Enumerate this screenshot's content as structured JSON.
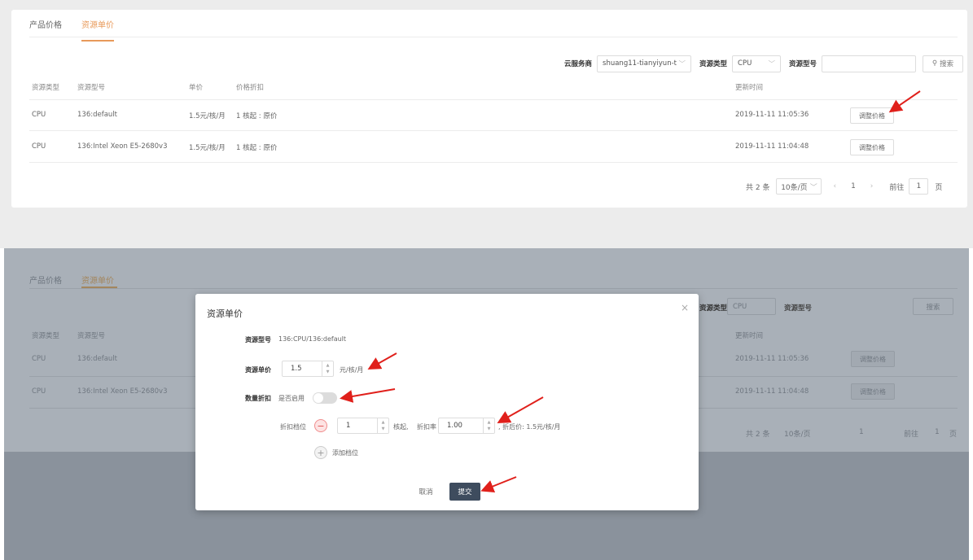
{
  "tabs": [
    {
      "label": "产品价格"
    },
    {
      "label": "资源单价"
    }
  ],
  "filters": {
    "cloud_label": "云服务商",
    "cloud_value": "shuang11-tianyiyun-t",
    "type_label": "资源类型",
    "type_value": "CPU",
    "model_label": "资源型号",
    "model_value": "",
    "search_label": "搜索"
  },
  "table": {
    "headers": [
      "资源类型",
      "资源型号",
      "单价",
      "价格折扣",
      "更新时间"
    ],
    "rows": [
      {
        "type": "CPU",
        "model": "136:default",
        "price": "1.5元/核/月",
        "discount": "1 核起 : 原价",
        "time": "2019-11-11 11:05:36",
        "action": "调整价格"
      },
      {
        "type": "CPU",
        "model": "136:Intel Xeon E5-2680v3",
        "price": "1.5元/核/月",
        "discount": "1 核起 : 原价",
        "time": "2019-11-11 11:04:48",
        "action": "调整价格"
      }
    ]
  },
  "pagination": {
    "total": "共 2 条",
    "page_size": "10条/页",
    "current": "1",
    "goto_label": "前往",
    "goto_value": "1",
    "page_unit": "页"
  },
  "modal": {
    "title": "资源单价",
    "model_label": "资源型号",
    "model_value": "136:CPU/136:default",
    "price_label": "资源单价",
    "price_value": "1.5",
    "price_unit": "元/核/月",
    "discount_label": "数量折扣",
    "discount_toggle_label": "是否启用",
    "tier_label": "折扣档位",
    "tier_cores": "1",
    "tier_cores_unit": "核起,",
    "tier_rate_label": "折扣率",
    "tier_rate": "1.00",
    "tier_result": ", 折后价: 1.5元/核/月",
    "add_tier_label": "添加档位",
    "cancel_label": "取消",
    "submit_label": "提交"
  },
  "colors": {
    "accent": "#e89a5a",
    "submit": "#3e4c5e",
    "annotation": "#e0201b"
  }
}
